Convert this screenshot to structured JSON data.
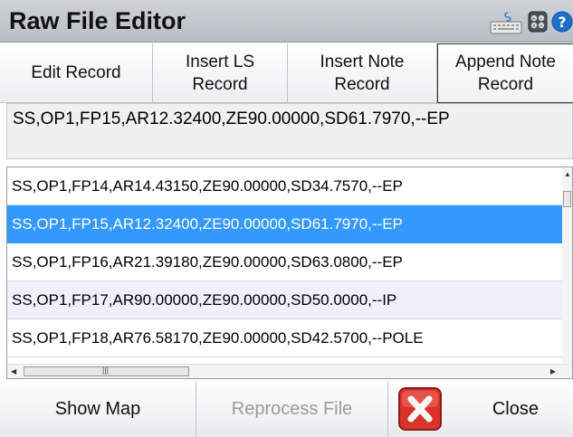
{
  "window": {
    "title": "Raw File Editor"
  },
  "toolbar_icons": [
    "keyboard-icon",
    "calculator-icon",
    "help-icon"
  ],
  "tabs": [
    {
      "label": "Edit Record"
    },
    {
      "label": "Insert LS\nRecord"
    },
    {
      "label": "Insert Note\nRecord"
    },
    {
      "label": "Append Note\nRecord",
      "active": true
    }
  ],
  "editor": {
    "value": "SS,OP1,FP15,AR12.32400,ZE90.00000,SD61.7970,--EP"
  },
  "records": [
    {
      "text": "SS,OP1,FP14,AR14.43150,ZE90.00000,SD34.7570,--EP"
    },
    {
      "text": "SS,OP1,FP15,AR12.32400,ZE90.00000,SD61.7970,--EP",
      "selected": true
    },
    {
      "text": "SS,OP1,FP16,AR21.39180,ZE90.00000,SD63.0800,--EP"
    },
    {
      "text": "SS,OP1,FP17,AR90.00000,ZE90.00000,SD50.0000,--IP"
    },
    {
      "text": "SS,OP1,FP18,AR76.58170,ZE90.00000,SD42.5700,--POLE"
    }
  ],
  "buttons": {
    "show_map": "Show Map",
    "reprocess_file": "Reprocess File",
    "close": "Close"
  },
  "colors": {
    "selection": "#3399ff",
    "title_bar": "#c3c7cc",
    "close_icon": "#d9342b",
    "help_icon": "#1f6fc9"
  }
}
